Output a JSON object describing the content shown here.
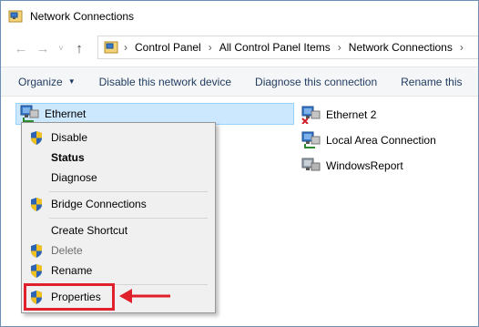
{
  "window": {
    "title": "Network Connections"
  },
  "nav": {
    "back_icon": "back-arrow-icon",
    "forward_icon": "forward-arrow-icon",
    "recent_icon": "chevron-down-icon",
    "up_icon": "up-arrow-icon"
  },
  "address": {
    "crumbs": [
      "Control Panel",
      "All Control Panel Items",
      "Network Connections"
    ]
  },
  "commands": {
    "organize": "Organize",
    "disable": "Disable this network device",
    "diagnose": "Diagnose this connection",
    "rename": "Rename this"
  },
  "connections": [
    {
      "label": "Ethernet",
      "state": "selected"
    },
    {
      "label": "Ethernet 2",
      "state": "disconnected"
    },
    {
      "label": "Local Area Connection",
      "state": "normal"
    },
    {
      "label": "WindowsReport",
      "state": "vpn"
    }
  ],
  "context_menu": {
    "items": [
      {
        "label": "Disable",
        "shield": true
      },
      {
        "label": "Status",
        "bold": true
      },
      {
        "label": "Diagnose"
      },
      {
        "label": "Bridge Connections",
        "shield": true
      },
      {
        "label": "Create Shortcut"
      },
      {
        "label": "Delete",
        "shield": true,
        "disabled": true
      },
      {
        "label": "Rename",
        "shield": true
      },
      {
        "label": "Properties",
        "shield": true
      }
    ]
  },
  "annotation": {
    "color": "#e0202a"
  }
}
